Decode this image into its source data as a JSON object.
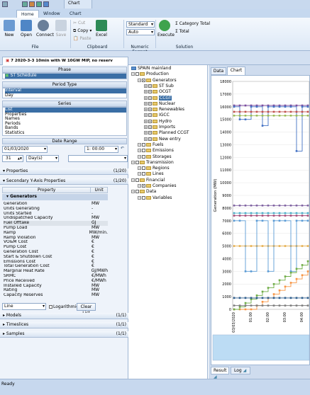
{
  "ribbon_tabs": {
    "home": "Home",
    "window": "Window",
    "chart": "Chart",
    "context": "Chart"
  },
  "ribbon": {
    "new": "New",
    "open": "Open",
    "connect": "Connect",
    "save": "Save",
    "cut": "Cut",
    "copy": "Copy",
    "paste": "Paste",
    "excel": "Excel",
    "standard": "Standard",
    "auto": "Auto",
    "execute": "Execute",
    "category_total": "Category Total",
    "total": "Total",
    "group_file": "File",
    "group_clipboard": "Clipboard",
    "group_numeric": "Numeric Format",
    "group_solution": "Solution"
  },
  "document_tab": "7 2020-3-3 10min with W 10GW MIP, no reserv",
  "left": {
    "phase_header": "Phase",
    "phase_item": "ST Schedule",
    "period_header": "Period Type",
    "periods": [
      "Interval",
      "Day"
    ],
    "series_header": "Series",
    "series_items": [
      "List",
      "Properties",
      "Names",
      "Periods",
      "Bands",
      "Statistics"
    ],
    "date_header": "Date Range",
    "date_value": "01/03/2020",
    "time_value": "1: 00:00",
    "count": "31",
    "unit": "Day(s)",
    "properties_label": "Properties",
    "properties_count": "(1/20)",
    "secondary_label": "Secondary Y-Axis Properties",
    "secondary_count": "(1/20)",
    "col_property": "Property",
    "col_unit": "Unit",
    "group": "Generators",
    "rows": [
      [
        "Generation",
        "MW"
      ],
      [
        "Units Generating",
        "-"
      ],
      [
        "Units Started",
        "-"
      ],
      [
        "Undispatched Capacity",
        "MW"
      ],
      [
        "Fuel Offtake",
        "GJ"
      ],
      [
        "Pump Load",
        "MW"
      ],
      [
        "Ramp",
        "MW/min."
      ],
      [
        "Ramp Violation",
        "MW"
      ],
      [
        "VO&M Cost",
        "€"
      ],
      [
        "Pump Cost",
        "€"
      ],
      [
        "Generation Cost",
        "€"
      ],
      [
        "Start & Shutdown Cost",
        "€"
      ],
      [
        "Emissions Cost",
        "€"
      ],
      [
        "Total Generation Cost",
        "€"
      ],
      [
        "Marginal Heat Rate",
        "GJ/MWh"
      ],
      [
        "SRMC",
        "€/MWh"
      ],
      [
        "Price Received",
        "€/MWh"
      ],
      [
        "Installed Capacity",
        "MW"
      ],
      [
        "Rating",
        "MW"
      ],
      [
        "Capacity Reserves",
        "MW"
      ]
    ],
    "chart_type": "Line",
    "log_label": "Logarithmic",
    "clear_list": "Clear List",
    "models": "Models",
    "models_count": "(1/1)",
    "timeslices": "Timeslices",
    "timeslices_count": "(1/1)",
    "samples": "Samples",
    "samples_count": "(1/1)"
  },
  "tree": [
    {
      "t": "SPAIN mainland",
      "d": 0
    },
    {
      "t": "Production",
      "d": 0
    },
    {
      "t": "Generators",
      "d": 1
    },
    {
      "t": "ST Sub",
      "d": 2
    },
    {
      "t": "OCGT",
      "d": 2
    },
    {
      "t": "CCGT",
      "d": 2
    },
    {
      "t": "Nuclear",
      "d": 2
    },
    {
      "t": "Renewables",
      "d": 2
    },
    {
      "t": "IGCC",
      "d": 2
    },
    {
      "t": "Hydro",
      "d": 2
    },
    {
      "t": "Imports",
      "d": 2
    },
    {
      "t": "Planned CCGT",
      "d": 2
    },
    {
      "t": "New entry",
      "d": 2
    },
    {
      "t": "Fuels",
      "d": 1
    },
    {
      "t": "Emissions",
      "d": 1
    },
    {
      "t": "Storages",
      "d": 1
    },
    {
      "t": "Transmission",
      "d": 0
    },
    {
      "t": "Regions",
      "d": 1
    },
    {
      "t": "Lines",
      "d": 1
    },
    {
      "t": "Financial",
      "d": 0
    },
    {
      "t": "Companies",
      "d": 1
    },
    {
      "t": "Data",
      "d": 0
    },
    {
      "t": "Variables",
      "d": 1
    }
  ],
  "view_tabs": {
    "data": "Data",
    "chart": "Chart",
    "result": "Result",
    "log": "Log"
  },
  "status": "Ready",
  "chart_data": {
    "type": "line",
    "ylabel": "Generation (MW)",
    "ylim": [
      0,
      18000
    ],
    "yticks": [
      "0",
      "1000",
      "2000",
      "3000",
      "4000",
      "5000",
      "6000",
      "7000",
      "8000",
      "9000",
      "10000",
      "11000",
      "12000",
      "13000",
      "14000",
      "15000",
      "16000",
      "17000",
      "18000"
    ],
    "xticks": [
      "03/03/2020",
      "01:00",
      "02:00",
      "03:00",
      "04:00"
    ],
    "series": [
      {
        "color": "#7b4fa0",
        "values": [
          16100,
          16100,
          16100,
          16100,
          16100,
          16100,
          16100,
          16100,
          16100,
          16100,
          16100,
          16100,
          16100,
          16100
        ]
      },
      {
        "color": "#4472c4",
        "values": [
          16000,
          15000,
          15000,
          16000,
          16000,
          14500,
          16000,
          16000,
          16000,
          16000,
          16000,
          12500,
          16000,
          16000
        ]
      },
      {
        "color": "#c0504d",
        "values": [
          15600,
          15600,
          15600,
          15600,
          15600,
          15600,
          15600,
          15600,
          15600,
          15600,
          15600,
          15600,
          15600,
          15600
        ]
      },
      {
        "color": "#9bbb59",
        "values": [
          15300,
          15300,
          15300,
          15300,
          15300,
          15300,
          15300,
          15300,
          15300,
          15300,
          15300,
          15300,
          15300,
          15300
        ]
      },
      {
        "color": "#f79646",
        "values": [
          0,
          0,
          0,
          0,
          300,
          600,
          900,
          1200,
          1500,
          1800,
          2100,
          2400,
          2700,
          3000
        ]
      },
      {
        "color": "#8064a2",
        "values": [
          8200,
          8200,
          8200,
          8200,
          8200,
          8200,
          8200,
          8200,
          8200,
          8200,
          8200,
          8200,
          8200,
          8200
        ]
      },
      {
        "color": "#4bacc6",
        "values": [
          7600,
          7600,
          7600,
          7600,
          7600,
          7600,
          7600,
          7600,
          7600,
          7600,
          7600,
          7600,
          7600,
          7600
        ]
      },
      {
        "color": "#a64d79",
        "values": [
          7400,
          7400,
          7400,
          7400,
          7400,
          7400,
          7400,
          7400,
          7400,
          7400,
          7400,
          7400,
          7400,
          7400
        ]
      },
      {
        "color": "#e6b050",
        "values": [
          5000,
          5000,
          5000,
          5000,
          5000,
          5000,
          5000,
          5000,
          5000,
          5000,
          5000,
          5000,
          5000,
          5000
        ]
      },
      {
        "color": "#5b9bd5",
        "values": [
          7000,
          7000,
          3000,
          3000,
          7000,
          7000,
          3000,
          7000,
          7000,
          7000,
          3000,
          7000,
          7000,
          7000
        ]
      },
      {
        "color": "#70ad47",
        "values": [
          0,
          200,
          500,
          800,
          1100,
          1400,
          1700,
          2000,
          2300,
          2600,
          2900,
          3200,
          3500,
          3800
        ]
      },
      {
        "color": "#2e5e8e",
        "values": [
          900,
          900,
          900,
          900,
          900,
          900,
          900,
          900,
          900,
          900,
          900,
          900,
          900,
          900
        ]
      },
      {
        "color": "#7f7f7f",
        "values": [
          300,
          300,
          300,
          300,
          300,
          300,
          300,
          300,
          300,
          300,
          300,
          300,
          300,
          300
        ]
      }
    ]
  }
}
